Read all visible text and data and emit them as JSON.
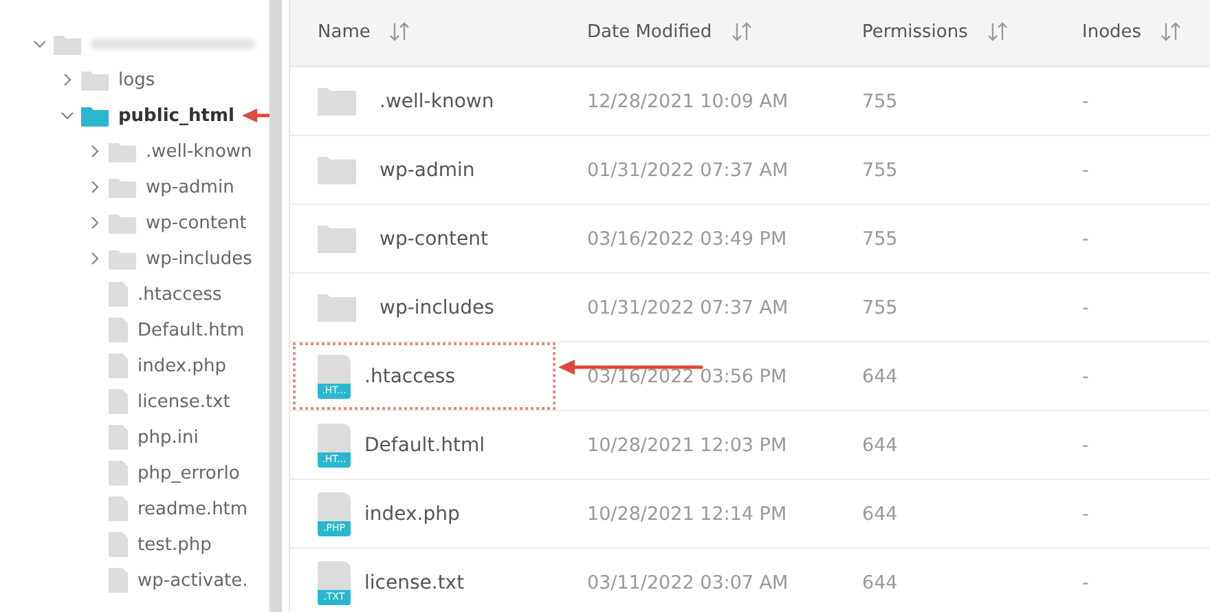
{
  "tree": {
    "kind": "folder",
    "expanded": true,
    "selected": false,
    "children": [
      {
        "name": "logs",
        "kind": "folder",
        "expanded": false,
        "selected": false
      },
      {
        "name": "public_html",
        "kind": "folder",
        "expanded": true,
        "selected": true,
        "annotation": {
          "kind": "arrow"
        },
        "children": [
          {
            "name": ".well-known",
            "kind": "folder",
            "expanded": false,
            "selected": false
          },
          {
            "name": "wp-admin",
            "kind": "folder",
            "expanded": false,
            "selected": false
          },
          {
            "name": "wp-content",
            "kind": "folder",
            "expanded": false,
            "selected": false
          },
          {
            "name": "wp-includes",
            "kind": "folder",
            "expanded": false,
            "selected": false
          },
          {
            "name": ".htaccess",
            "kind": "file",
            "selected": false
          },
          {
            "name": "Default.htm",
            "kind": "file",
            "selected": false
          },
          {
            "name": "index.php",
            "kind": "file",
            "selected": false
          },
          {
            "name": "license.txt",
            "kind": "file",
            "selected": false
          },
          {
            "name": "php.ini",
            "kind": "file",
            "selected": false
          },
          {
            "name": "php_errorlo",
            "kind": "file",
            "selected": false
          },
          {
            "name": "readme.htm",
            "kind": "file",
            "selected": false
          },
          {
            "name": "test.php",
            "kind": "file",
            "selected": false
          },
          {
            "name": "wp-activate.",
            "kind": "file",
            "selected": false
          }
        ]
      }
    ]
  },
  "table": {
    "columns": [
      "Name",
      "Date Modified",
      "Permissions",
      "Inodes"
    ],
    "rows": [
      {
        "kind": "folder",
        "name": ".well-known",
        "date": "12/28/2021 10:09 AM",
        "permissions": "755",
        "inodes": "-"
      },
      {
        "kind": "folder",
        "name": "wp-admin",
        "date": "01/31/2022 07:37 AM",
        "permissions": "755",
        "inodes": "-"
      },
      {
        "kind": "folder",
        "name": "wp-content",
        "date": "03/16/2022 03:49 PM",
        "permissions": "755",
        "inodes": "-"
      },
      {
        "kind": "folder",
        "name": "wp-includes",
        "date": "01/31/2022 07:37 AM",
        "permissions": "755",
        "inodes": "-"
      },
      {
        "kind": "file",
        "badge": ".HT...",
        "name": ".htaccess",
        "date": "03/16/2022 03:56 PM",
        "permissions": "644",
        "inodes": "-",
        "annotation": {
          "kind": "box-arrow"
        }
      },
      {
        "kind": "file",
        "badge": ".HT...",
        "name": "Default.html",
        "date": "10/28/2021 12:03 PM",
        "permissions": "644",
        "inodes": "-"
      },
      {
        "kind": "file",
        "badge": ".PHP",
        "name": "index.php",
        "date": "10/28/2021 12:14 PM",
        "permissions": "644",
        "inodes": "-"
      },
      {
        "kind": "file",
        "badge": ".TXT",
        "name": "license.txt",
        "date": "03/11/2022 03:07 AM",
        "permissions": "644",
        "inodes": "-"
      }
    ]
  }
}
